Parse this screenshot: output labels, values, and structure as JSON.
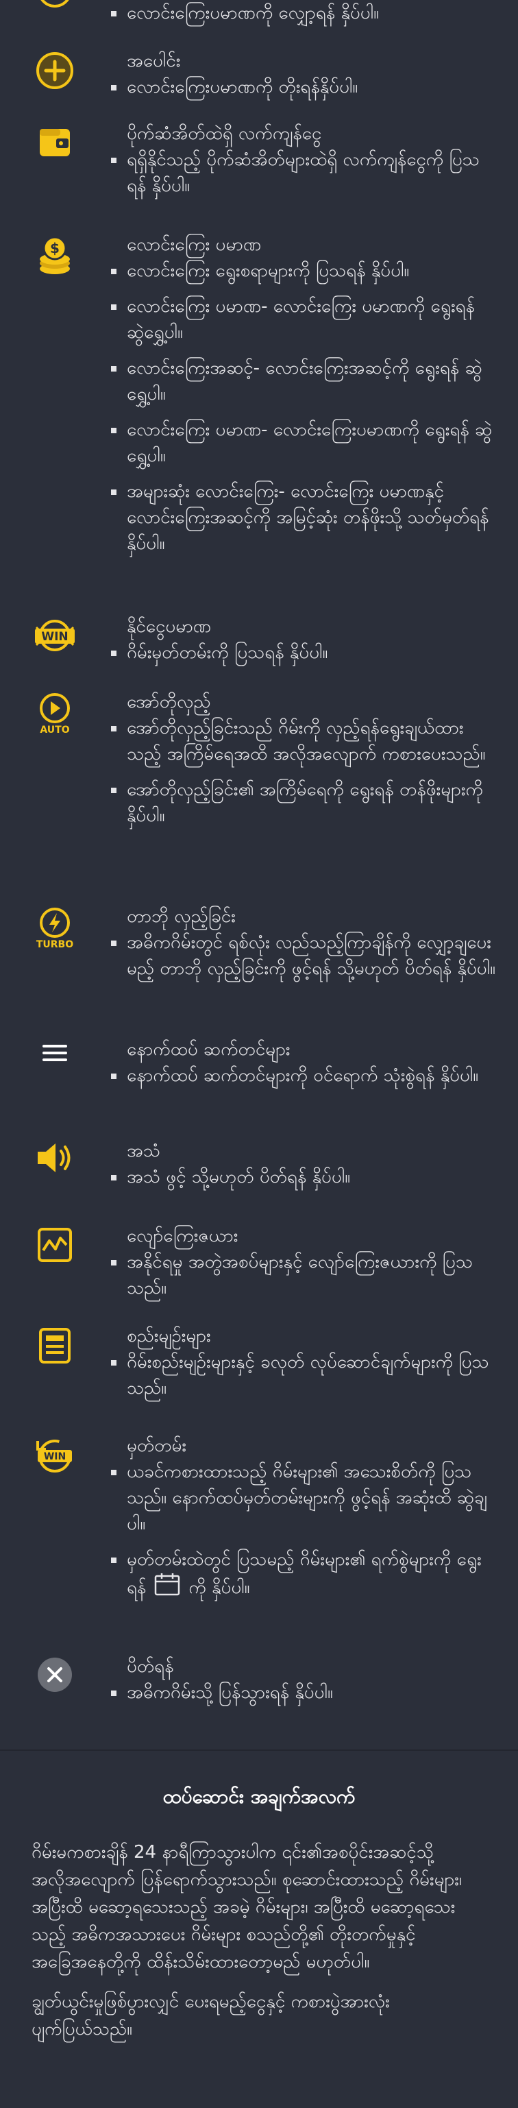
{
  "rows": [
    {
      "icon": "coin-icon",
      "title": "",
      "bullets": [
        "လောင်းကြေးပမာဏကို လျှော့ရန် နှိပ်ပါ။"
      ]
    },
    {
      "icon": "plus-circle-icon",
      "title": "အပေါင်း",
      "bullets": [
        "လောင်းကြေးပမာဏကို တိုးရန်နှိပ်ပါ။"
      ]
    },
    {
      "icon": "wallet-icon",
      "title": "ပိုက်ဆံအိတ်ထဲရှိ လက်ကျန်ငွေ",
      "bullets": [
        "ရရှိနိုင်သည့် ပိုက်ဆံအိတ်များထဲရှိ လက်ကျန်ငွေကို ပြသရန် နှိပ်ပါ။"
      ]
    },
    {
      "icon": "coin-stack-icon",
      "title": "လောင်းကြေး ပမာဏ",
      "bullets": [
        "လောင်းကြေး ရွေးစရာများကို ပြသရန် နှိပ်ပါ။",
        "လောင်းကြေး ပမာဏ- လောင်းကြေး ပမာဏကို ရွေးရန် ဆွဲရွှေ့ပါ။",
        "လောင်းကြေးအဆင့်- လောင်းကြေးအဆင့်ကို ရွေးရန် ဆွဲရွှေ့ပါ။",
        "လောင်းကြေး ပမာဏ- လောင်းကြေးပမာဏကို ရွေးရန် ဆွဲရွှေ့ပါ။",
        "အများဆုံး လောင်းကြေး- လောင်းကြေး ပမာဏနှင့် လောင်းကြေးအဆင့်ကို အမြင့်ဆုံး တန်ဖိုးသို့ သတ်မှတ်ရန် နှိပ်ပါ။"
      ]
    },
    {
      "icon": "win-icon",
      "icon_text": "WIN",
      "title": "နိုင်ငွေပမာဏ",
      "bullets": [
        "ဂိမ်းမှတ်တမ်းကို ပြသရန် နှိပ်ပါ။"
      ]
    },
    {
      "icon": "auto-play-icon",
      "icon_text": "AUTO",
      "title": "အော်တိုလှည့်",
      "bullets": [
        "အော်တိုလှည့်ခြင်းသည် ဂိမ်းကို လှည့်ရန်ရွေးချယ်ထားသည့် အကြိမ်ရေအထိ အလိုအလျောက် ကစားပေးသည်။",
        "အော်တိုလှည့်ခြင်း၏ အကြိမ်ရေကို ရွေးရန် တန်ဖိုးများကို နှိပ်ပါ။"
      ]
    },
    {
      "icon": "turbo-icon",
      "icon_text": "TURBO",
      "title": "တာဘို လှည့်ခြင်း",
      "bullets": [
        "အဓိကဂိမ်းတွင် ရစ်လုံး လည်သည့်ကြာချိန်ကို လျှော့ချပေးမည့် တာဘို လှည့်ခြင်းကို ဖွင့်ရန် သို့မဟုတ် ပိတ်ရန် နှိပ်ပါ။"
      ]
    },
    {
      "icon": "menu-icon",
      "title": "နောက်ထပ် ဆက်တင်များ",
      "bullets": [
        "နောက်ထပ် ဆက်တင်များကို ဝင်ရောက် သုံးစွဲရန် နှိပ်ပါ။"
      ]
    },
    {
      "icon": "sound-icon",
      "title": "အသံ",
      "bullets": [
        "အသံ ဖွင့် သို့မဟုတ် ပိတ်ရန် နှိပ်ပါ။"
      ]
    },
    {
      "icon": "paytable-icon",
      "title": "လျော်ကြေးဇယား",
      "bullets": [
        "အနိုင်ရမှု အတွဲအစပ်များနှင့် လျော်ကြေးဇယားကို ပြသသည်။"
      ]
    },
    {
      "icon": "rules-icon",
      "title": "စည်းမျဉ်းများ",
      "bullets": [
        "ဂိမ်းစည်းမျဉ်းများနှင့် ခလုတ် လုပ်ဆောင်ချက်များကို ပြသသည်။"
      ]
    },
    {
      "icon": "history-icon",
      "icon_text": "WIN",
      "title": "မှတ်တမ်း",
      "bullets": [
        "ယခင်ကစားထားသည့် ဂိမ်းများ၏ အသေးစိတ်ကို ပြသသည်။ နောက်ထပ်မှတ်တမ်းများကို ဖွင့်ရန် အဆုံးထိ ဆွဲချပါ။",
        "မှတ်တမ်းထဲတွင် ပြသမည့် ဂိမ်းများ၏ ရက်စွဲများကို ရွေးရန်|calendar-icon|ကို နှိပ်ပါ။"
      ]
    },
    {
      "icon": "close-icon",
      "title": "ပိတ်ရန်",
      "bullets": [
        "အဓိကဂိမ်းသို့ ပြန်သွားရန် နှိပ်ပါ။"
      ]
    }
  ],
  "info": {
    "title": "ထပ်ဆောင်း အချက်အလက်",
    "paragraphs": [
      "ဂိမ်းမကစားချိန် 24 နာရီကြာသွားပါက ၎င်း၏အစပိုင်းအဆင့်သို့ အလိုအလျောက် ပြန်ရောက်သွားသည်။ စုဆောင်းထားသည့် ဂိမ်းများ၊ အပြီးထိ မဆော့ရသေးသည့် အခမဲ့ ဂိမ်းများ၊ အပြီးထိ မဆော့ရသေးသည့် အဓိကအသားပေး ဂိမ်းများ စသည်တို့၏ တိုးတက်မှုနှင့် အခြေအနေတို့ကို ထိန်းသိမ်းထားတော့မည် မဟုတ်ပါ။",
      "ချွတ်ယွင်းမှုဖြစ်ပွားလျှင် ပေးရမည့်ငွေနှင့် ကစားပွဲအားလုံး ပျက်ပြယ်သည်။"
    ]
  },
  "colors": {
    "background": "#2b2f3a",
    "accent_gold": "#f5c518",
    "close_circle": "#6b6e76",
    "text": "#e6e6e9"
  }
}
